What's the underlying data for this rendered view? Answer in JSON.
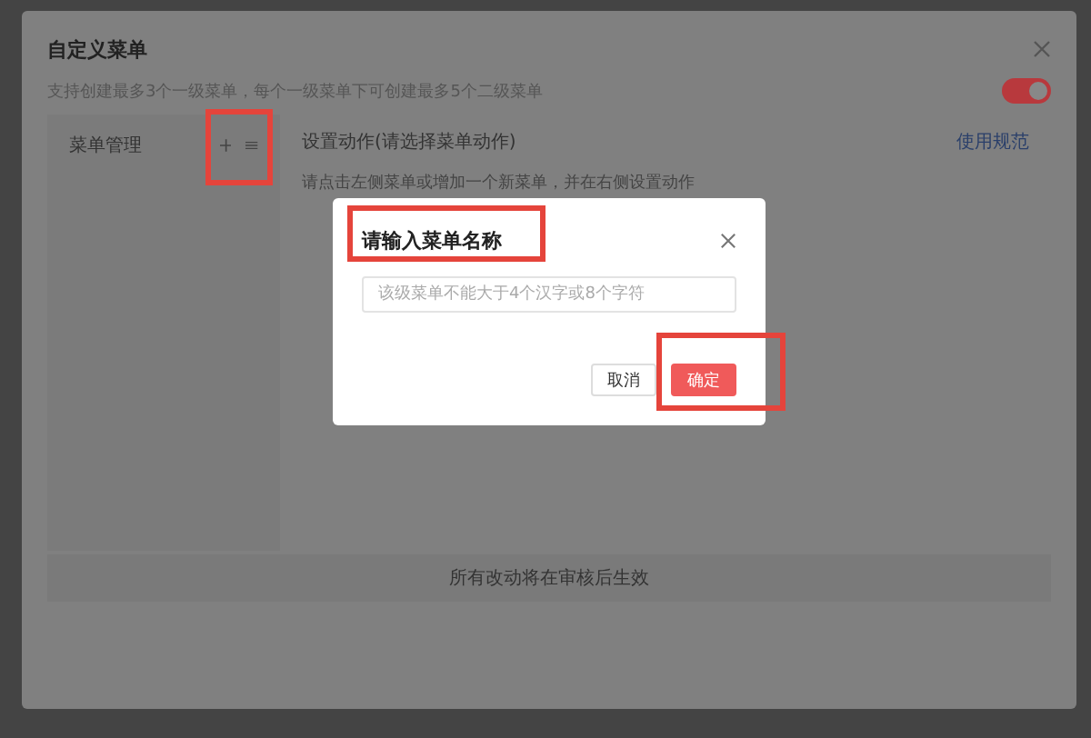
{
  "dialog": {
    "title": "自定义菜单",
    "subtitle": "支持创建最多3个一级菜单，每个一级菜单下可创建最多5个二级菜单",
    "toggle": {
      "on": true
    },
    "menu_panel": {
      "title": "菜单管理"
    },
    "action_panel": {
      "title": "设置动作(请选择菜单动作)",
      "link": "使用规范",
      "hint": "请点击左侧菜单或增加一个新菜单，并在右侧设置动作"
    },
    "notice": "所有改动将在审核后生效"
  },
  "modal": {
    "title": "请输入菜单名称",
    "input": {
      "placeholder": "该级菜单不能大于4个汉字或8个字符"
    },
    "buttons": [
      {
        "label": "取消",
        "kind": "secondary"
      },
      {
        "label": "确定",
        "kind": "primary"
      }
    ]
  }
}
